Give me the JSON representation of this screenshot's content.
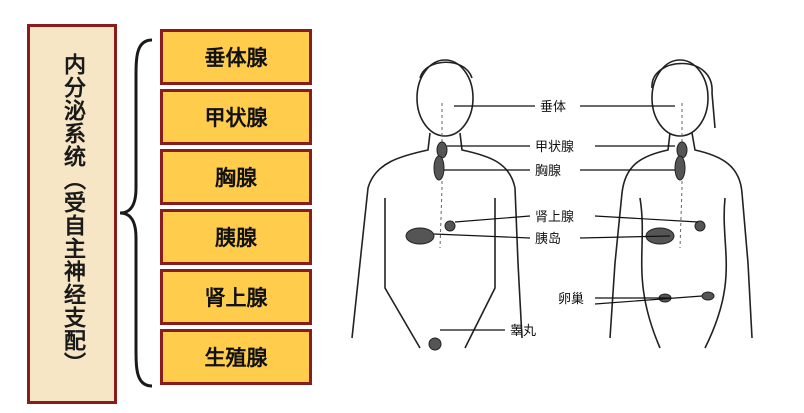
{
  "title": "内分泌系统（受自主神经支配）",
  "glands": [
    "垂体腺",
    "甲状腺",
    "胸腺",
    "胰腺",
    "肾上腺",
    "生殖腺"
  ],
  "diagram_labels": {
    "pituitary": "垂体",
    "thyroid": "甲状腺",
    "thymus": "胸腺",
    "adrenal": "肾上腺",
    "islets": "胰岛",
    "ovary": "卵巢",
    "testis": "睾丸"
  },
  "colors": {
    "title_bg": "#f7e6c5",
    "gland_bg": "#ffcc4c",
    "border": "#8b1c1c"
  }
}
